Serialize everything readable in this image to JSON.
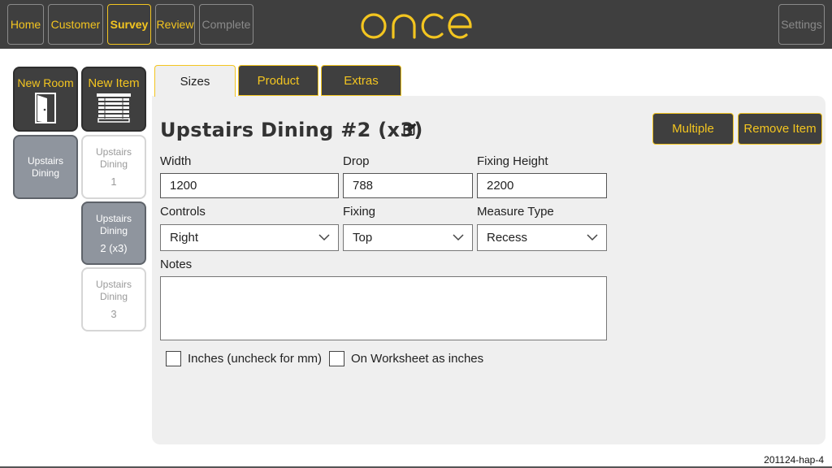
{
  "nav": {
    "home": "Home",
    "customer": "Customer",
    "survey": "Survey",
    "review": "Review",
    "complete": "Complete",
    "settings": "Settings"
  },
  "logo": {
    "text": "once",
    "color": "#f3c520"
  },
  "sidebar": {
    "new_room": "New Room",
    "new_item": "New Item",
    "room": {
      "line1": "Upstairs",
      "line2": "Dining"
    },
    "items": [
      {
        "line1": "Upstairs",
        "line2": "Dining",
        "num": "1"
      },
      {
        "line1": "Upstairs",
        "line2": "Dining",
        "num": "2 (x3)"
      },
      {
        "line1": "Upstairs",
        "line2": "Dining",
        "num": "3"
      }
    ]
  },
  "tabs": {
    "sizes": "Sizes",
    "product": "Product",
    "extras": "Extras"
  },
  "item": {
    "title": "Upstairs Dining #2 (x3)",
    "multiple_button": "Multiple",
    "remove_button": "Remove Item"
  },
  "form": {
    "width_label": "Width",
    "width_value": "1200",
    "drop_label": "Drop",
    "drop_value": "788",
    "fixing_height_label": "Fixing Height",
    "fixing_height_value": "2200",
    "controls_label": "Controls",
    "controls_value": "Right",
    "fixing_label": "Fixing",
    "fixing_value": "Top",
    "measure_type_label": "Measure Type",
    "measure_type_value": "Recess",
    "notes_label": "Notes",
    "notes_value": "",
    "inches_label": "Inches (uncheck for mm)",
    "worksheet_label": "On Worksheet as inches"
  },
  "version": "201124-hap-4",
  "colors": {
    "accent": "#f3c520",
    "dark": "#3f3f3f",
    "panel": "#efefef"
  }
}
